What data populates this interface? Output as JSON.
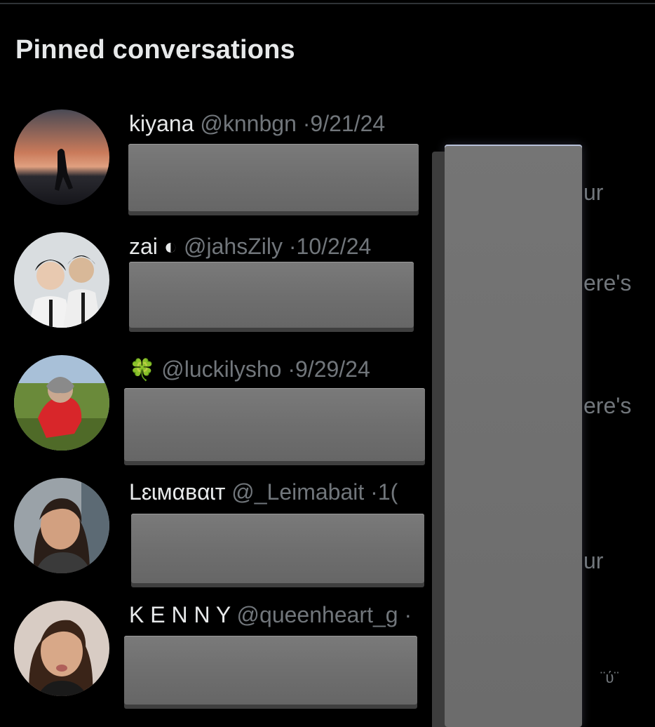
{
  "section": {
    "title": "Pinned conversations"
  },
  "conversations": [
    {
      "name": "kiyana",
      "handle": "@knnbgn",
      "separator": "·",
      "date": "9/21/24",
      "preview_fragment": "ur"
    },
    {
      "name": "zai ◐",
      "handle": "@jahsZily",
      "separator": "·",
      "date": "10/2/24",
      "preview_fragment": "ere's"
    },
    {
      "name": "🍀",
      "handle": "@luckilysho",
      "separator": "·",
      "date": "9/29/24",
      "preview_fragment": "ere's"
    },
    {
      "name": "Lɛɩмαвαɩт",
      "handle": "@_Leimabait",
      "separator": "·",
      "date": "1(",
      "preview_fragment": "ur"
    },
    {
      "name": "K E N N Y",
      "handle": "@queenheart_g",
      "separator": "·",
      "date": "",
      "preview_fragment": "¨ύ¨"
    }
  ],
  "colors": {
    "background": "#000000",
    "primary_text": "#e7e9ea",
    "secondary_text": "#71767b",
    "redaction": "#6f6f6f"
  }
}
